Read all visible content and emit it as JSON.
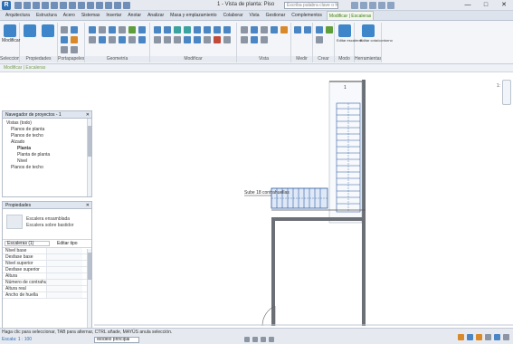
{
  "titlebar": {
    "title": "1 - Vista de planta: Piso",
    "search_placeholder": "Escriba palabra clave o frase",
    "window_controls": [
      "—",
      "□",
      "✕"
    ]
  },
  "ribbon": {
    "tabs": [
      "Arquitectura",
      "Estructura",
      "Acero",
      "Sistemas",
      "Insertar",
      "Anotar",
      "Analizar",
      "Masa y emplazamiento",
      "Colaborar",
      "Vista",
      "Gestionar",
      "Complementos",
      "Modificar | Escaleras"
    ],
    "active_tab_index": 12,
    "groups": [
      {
        "label": "Seleccionar",
        "button": "Modificar"
      },
      {
        "label": "Propiedades",
        "button": ""
      },
      {
        "label": "Portapapeles"
      },
      {
        "label": "Geometría"
      },
      {
        "label": "Modificar"
      },
      {
        "label": "Vista"
      },
      {
        "label": "Medir"
      },
      {
        "label": "Crear"
      },
      {
        "label": "Modo"
      },
      {
        "label": "Herramientas"
      }
    ],
    "mode_buttons": [
      "Editar escaleras",
      "Editar cota/contorno"
    ]
  },
  "options_bar": {
    "text": "Modificar | Escaleras"
  },
  "project_browser": {
    "title": "Navegador de proyectos - 1",
    "items": [
      "Vistas (todo)",
      "Planos de planta",
      "Planos de techo",
      "Alzado",
      "Planta",
      "Planta de planta",
      "Nivel",
      "Planos de techo"
    ]
  },
  "properties": {
    "title": "Propiedades",
    "type_name": "Escalera ensamblada",
    "type_subname": "Escalera sobre bastidor",
    "selector": "Escaleras (1)",
    "edit_type": "Editar tipo",
    "rows": [
      "Nivel base",
      "Desfase base",
      "Nivel superior",
      "Desfase superior",
      "Altura",
      "Número de contrahuellas",
      "Altura real",
      "Ancho de huella"
    ]
  },
  "status": {
    "line1": "Haga clic para seleccionar, TAB para alternar, CTRL añade, MAYÚS anula selección.",
    "line2": "Escala: 1 : 100",
    "combo": "Modelo principal",
    "model_label": "Principal"
  },
  "canvas": {
    "annotation": "Sube 18 contrahuellas",
    "side_label": "1"
  }
}
